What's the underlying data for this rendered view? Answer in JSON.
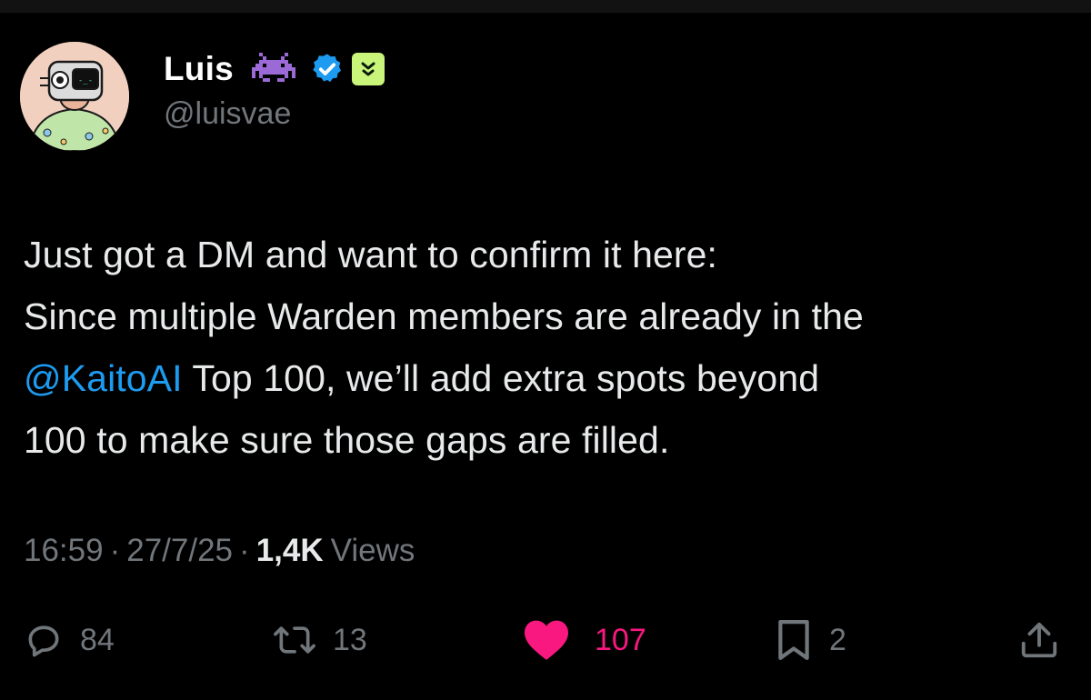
{
  "author": {
    "display_name": "Luis",
    "handle": "@luisvae",
    "name_emoji": "alien-monster-icon",
    "verified": true,
    "affiliate_badge": "affiliate-badge-icon"
  },
  "tweet": {
    "line1": "Just got a DM and want to confirm it here:",
    "line2": "Since multiple Warden members are already in the",
    "mention": "@KaitoAI",
    "line3_rest": " Top 100, we’ll add extra spots beyond",
    "line4": "100 to make sure those gaps are filled."
  },
  "meta": {
    "time": "16:59",
    "separator": "·",
    "date": "27/7/25",
    "views_count": "1,4K",
    "views_label": "Views"
  },
  "actions": {
    "replies": "84",
    "reposts": "13",
    "likes": "107",
    "bookmarks": "2"
  },
  "colors": {
    "background": "#000000",
    "text": "#e7e9ea",
    "muted": "#71767b",
    "link": "#1d9bf0",
    "like": "#f91880",
    "verified": "#1d9bf0",
    "affiliate": "#c8f57a"
  }
}
